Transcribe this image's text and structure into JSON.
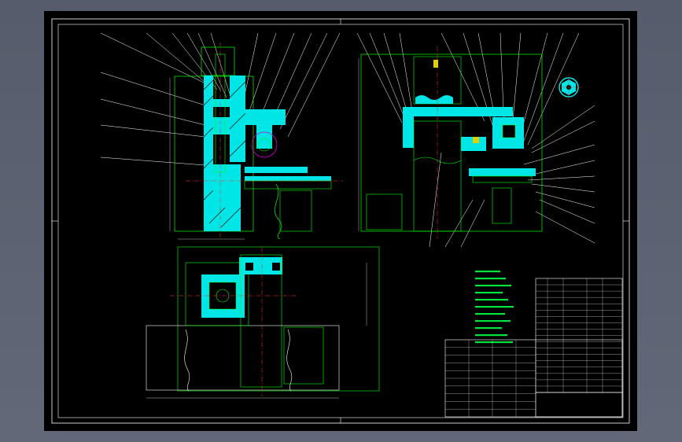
{
  "drawing": {
    "colors": {
      "background": "#000000",
      "frame": "#ffffff",
      "section_fill": "#00e5e5",
      "outline": "#00ff00",
      "dimension": "#e6e6e6",
      "magenta_circle": "#d000d0",
      "notes": "#00e23c",
      "red_centerline": "#ff3030",
      "yellow_part": "#e0d000"
    },
    "views": [
      "front-section-view",
      "side-section-view",
      "plan-view",
      "detail-view"
    ],
    "technical_requirements_lines": 11,
    "parts_list_rows_upper": 18,
    "parts_list_rows_lower": 10
  }
}
